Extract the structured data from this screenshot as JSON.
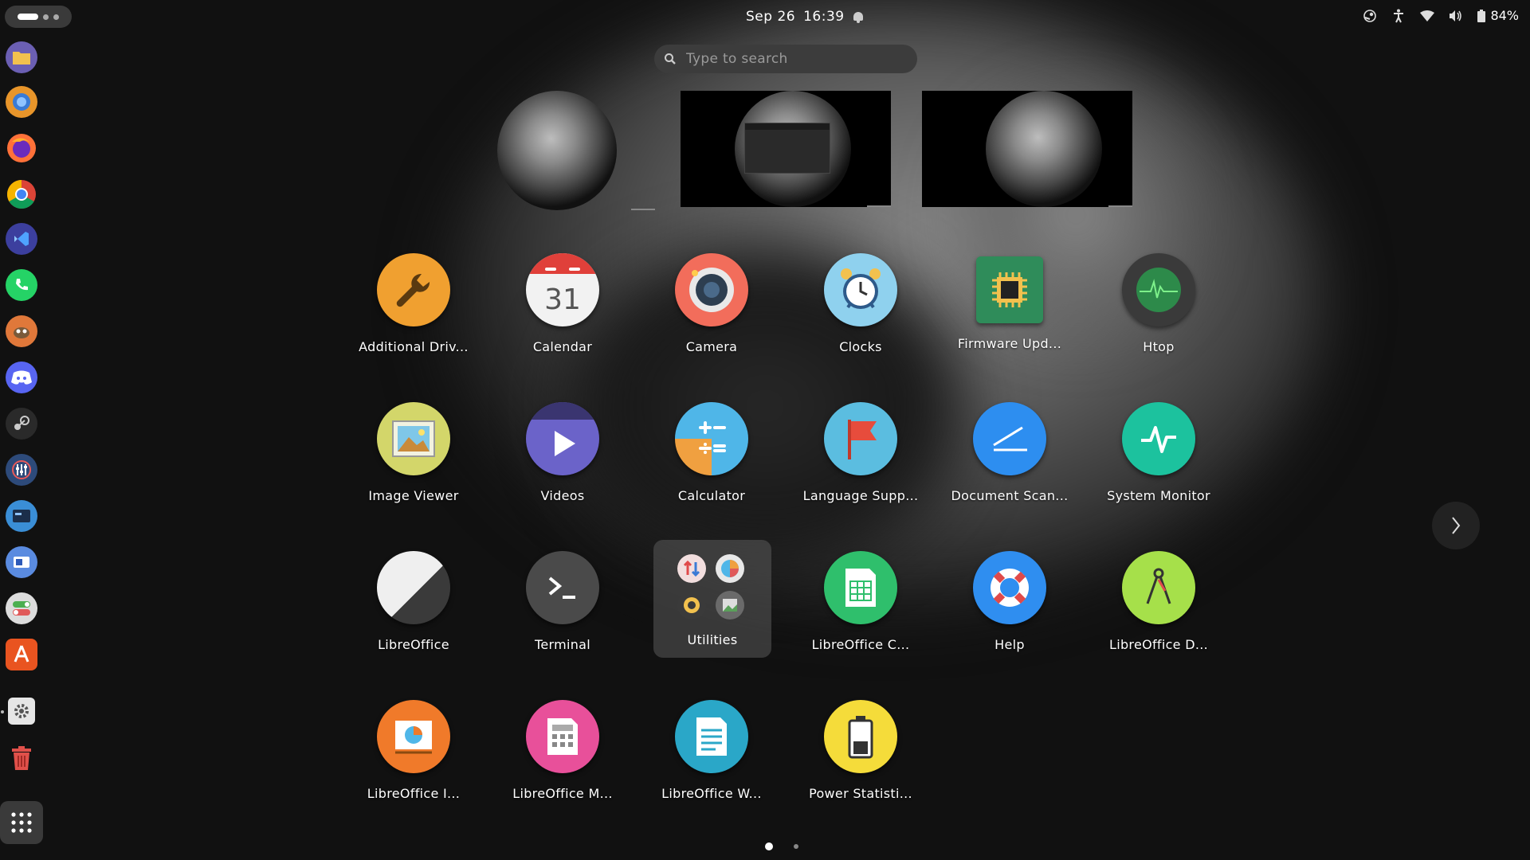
{
  "topbar": {
    "date": "Sep 26",
    "time": "16:39",
    "battery": "84%"
  },
  "search": {
    "placeholder": "Type to search"
  },
  "dock": {
    "items": [
      "files-icon",
      "web-browser-icon",
      "firefox-icon",
      "chrome-icon",
      "vscode-icon",
      "whatsapp-icon",
      "gimp-icon",
      "discord-icon",
      "steam-icon",
      "mixer-icon",
      "window-app-icon",
      "remote-app-icon",
      "tweaks-icon",
      "app-store-icon",
      "settings-icon",
      "trash-icon",
      "show-apps-icon"
    ]
  },
  "apps": {
    "row1": [
      "Additional Driv...",
      "Calendar",
      "Camera",
      "Clocks",
      "Firmware Upd...",
      "Htop"
    ],
    "row2": [
      "Image Viewer",
      "Videos",
      "Calculator",
      "Language Supp...",
      "Document Scan...",
      "System Monitor"
    ],
    "row3": [
      "LibreOffice",
      "Terminal",
      "Utilities",
      "LibreOffice C...",
      "Help",
      "LibreOffice D..."
    ],
    "row4": [
      "LibreOffice I...",
      "LibreOffice M...",
      "LibreOffice W...",
      "Power Statisti..."
    ]
  },
  "calendar_day": "31",
  "colors": {
    "additional_drivers": "#f0a030",
    "camera": "#f26d5b",
    "clocks": "#8fd1ee",
    "firmware": "#2f8c5a",
    "htop": "#3a3a3a",
    "image_viewer": "#d3d66a",
    "videos": "#6b63c9",
    "language": "#5bbde0",
    "document_scan": "#2d8ef0",
    "system_monitor": "#1cc29e",
    "terminal": "#4a4a4a",
    "libre_calc": "#2fbf6c",
    "help": "#2f8ef0",
    "libre_draw": "#a6e04a",
    "libre_impress": "#f07a2a",
    "libre_math": "#e8509a",
    "libre_writer": "#2aa7c8",
    "power": "#f5dc3a"
  }
}
